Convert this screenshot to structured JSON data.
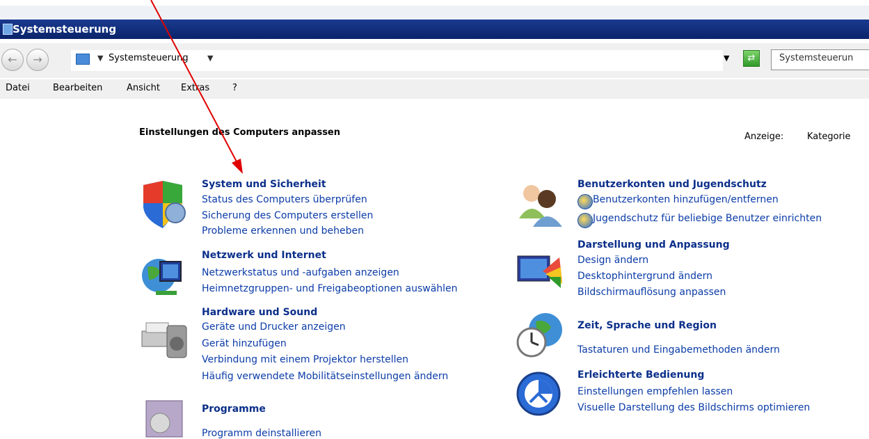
{
  "window": {
    "title": "Systemsteuerung"
  },
  "address": {
    "path": "Systemsteuerung",
    "search_placeholder": "Systemsteuerun"
  },
  "menu": [
    "Datei",
    "Bearbeiten",
    "Ansicht",
    "Extras",
    "?"
  ],
  "main": {
    "heading": "Einstellungen des Computers anpassen",
    "view_label": "Anzeige:",
    "view_value": "Kategorie"
  },
  "categories": [
    {
      "title": "System und Sicherheit",
      "links": [
        "Status des Computers überprüfen",
        "Sicherung des Computers erstellen",
        "Probleme erkennen und beheben"
      ]
    },
    {
      "title": "Netzwerk und Internet",
      "links": [
        "Netzwerkstatus und -aufgaben anzeigen",
        "Heimnetzgruppen- und Freigabeoptionen auswählen"
      ]
    },
    {
      "title": "Hardware und Sound",
      "links": [
        "Geräte und Drucker anzeigen",
        "Gerät hinzufügen",
        "Verbindung mit einem Projektor herstellen",
        "Häufig verwendete Mobilitätseinstellungen ändern"
      ]
    },
    {
      "title": "Programme",
      "links": [
        "Programm deinstallieren"
      ]
    },
    {
      "title": "Benutzerkonten und Jugendschutz",
      "links": [
        "Benutzerkonten hinzufügen/entfernen",
        "Jugendschutz für beliebige Benutzer einrichten"
      ]
    },
    {
      "title": "Darstellung und Anpassung",
      "links": [
        "Design ändern",
        "Desktophintergrund ändern",
        "Bildschirmauflösung anpassen"
      ]
    },
    {
      "title": "Zeit, Sprache und Region",
      "links": [
        "Tastaturen und Eingabemethoden ändern"
      ]
    },
    {
      "title": "Erleichterte Bedienung",
      "links": [
        "Einstellungen empfehlen lassen",
        "Visuelle Darstellung des Bildschirms optimieren"
      ]
    }
  ],
  "colors": {
    "titlebar": "#0a246a",
    "category_title": "#0b2f8a",
    "link": "#0b3ca8",
    "annotation_arrow": "#e00000"
  }
}
